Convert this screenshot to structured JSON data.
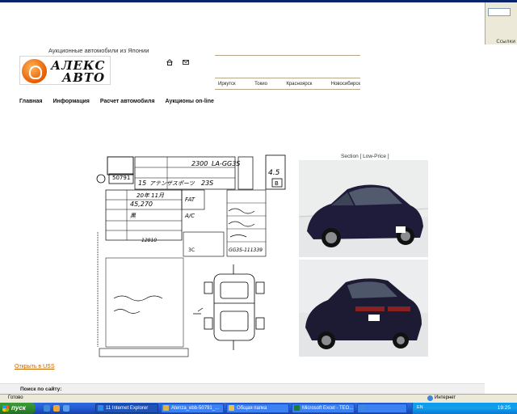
{
  "browser": {
    "links_label": "Ссылки",
    "status_ready": "Готово",
    "status_zone": "Интернет"
  },
  "header": {
    "tagline": "Аукционные автомобили из Японии",
    "logo_top": "АЛЕКС",
    "logo_bottom": "АВТО",
    "cities": [
      "Иркутск",
      "Токио",
      "Красноярск",
      "Новосибирск"
    ]
  },
  "nav": [
    "Главная",
    "Информация",
    "Расчет автомобиля",
    "Аукционы on-line"
  ],
  "content": {
    "section_label": "Section [ Low-Price ]",
    "open_link": "Открыть в USS",
    "search_label": "Поиск по сайту:",
    "sheet": {
      "lot": "50791",
      "engine_cc": "2300",
      "model_code": "LA-GG3S",
      "grade": "4.5",
      "grade_sub": "B",
      "year": "15",
      "model_name": "アテンザスポーツ",
      "trim": "23S",
      "mileage": "45,270",
      "transmission": "FAT",
      "aircon": "A/C",
      "color": "黒",
      "inspection_month": "20年 11月",
      "recycle_fee": "12810",
      "chassis_no": "GG3S-111339",
      "size": "3C"
    }
  },
  "taskbar": {
    "start_label": "пуск",
    "tasks": [
      {
        "label": "11 Internet Explorer",
        "color": "#2b8ae8"
      },
      {
        "label": "Atenza_ebb-50791_...",
        "color": "#d9b44a"
      },
      {
        "label": "Общая папка",
        "color": "#e8c04a"
      },
      {
        "label": "Microsoft Excel - ТЕО...",
        "color": "#1d7a3c"
      },
      {
        "label": "",
        "color": "#3a8ad8"
      }
    ],
    "tray_lang": "EN",
    "clock": "19:25"
  }
}
